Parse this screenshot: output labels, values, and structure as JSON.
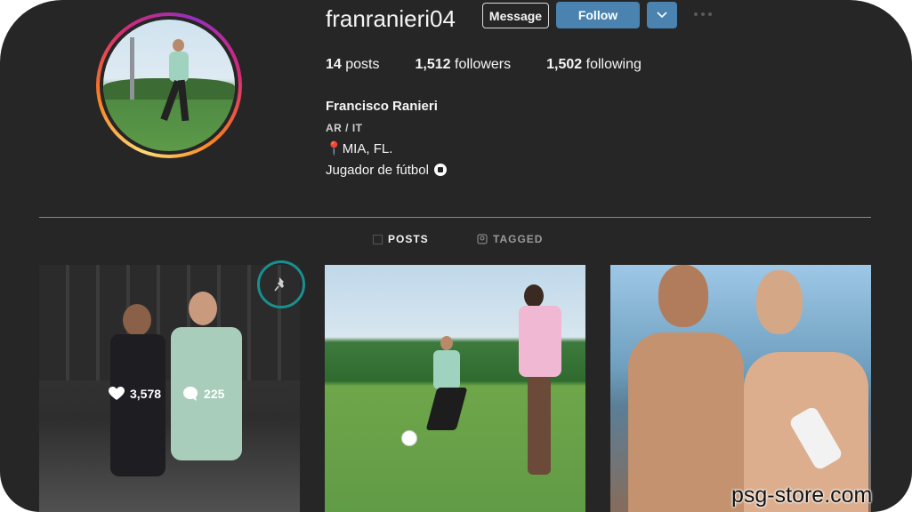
{
  "profile": {
    "username": "franranieri04",
    "message_label": "Message",
    "follow_label": "Follow"
  },
  "stats": {
    "posts_count": "14",
    "posts_label": "posts",
    "followers_count": "1,512",
    "followers_label": "followers",
    "following_count": "1,502",
    "following_label": "following"
  },
  "bio": {
    "full_name": "Francisco Ranieri",
    "category": "AR / IT",
    "location": "MIA, FL.",
    "description": "Jugador de fútbol"
  },
  "tabs": [
    {
      "label": "POSTS",
      "icon": "grid-icon",
      "active": true
    },
    {
      "label": "TAGGED",
      "icon": "tagged-icon",
      "active": false
    }
  ],
  "posts": [
    {
      "likes": "3,578",
      "comments": "225",
      "pinned": true
    },
    {
      "pinned": false
    },
    {
      "pinned": false
    }
  ],
  "watermark": "psg-store.com",
  "colors": {
    "background": "#262626",
    "follow_button": "#4a83b0",
    "pin_highlight": "#1a8f8f"
  }
}
